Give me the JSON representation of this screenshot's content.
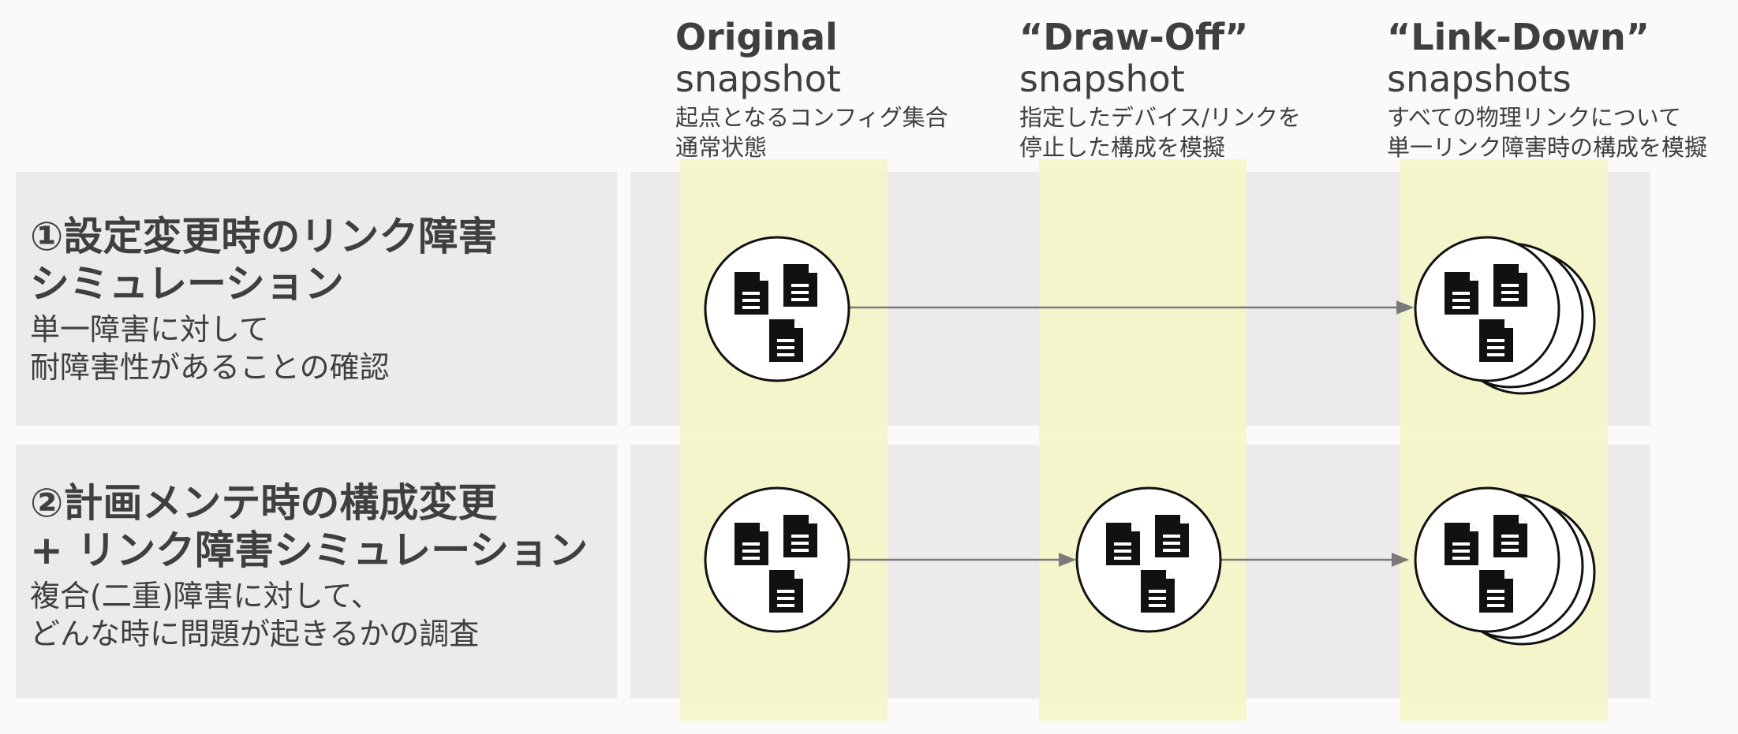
{
  "columns": [
    {
      "title": "Original",
      "subtitle": "snapshot",
      "desc1": "起点となるコンフィグ集合",
      "desc2": "通常状態"
    },
    {
      "title": "“Draw-Off”",
      "subtitle": "snapshot",
      "desc1": "指定したデバイス/リンクを",
      "desc2": "停止した構成を模擬"
    },
    {
      "title": "“Link-Down”",
      "subtitle": "snapshots",
      "desc1": "すべての物理リンクについて",
      "desc2": "単一リンク障害時の構成を模擬"
    }
  ],
  "rows": [
    {
      "title1": "①設定変更時のリンク障害",
      "title2": "シミュレーション",
      "desc1": "単一障害に対して",
      "desc2": "耐障害性があることの確認"
    },
    {
      "title1": "②計画メンテ時の構成変更",
      "title2": "+ リンク障害シミュレーション",
      "desc1": "複合(二重)障害に対して、",
      "desc2": "どんな時に問題が起きるかの調査"
    }
  ],
  "icons": {
    "snapshot": "document-icon"
  }
}
